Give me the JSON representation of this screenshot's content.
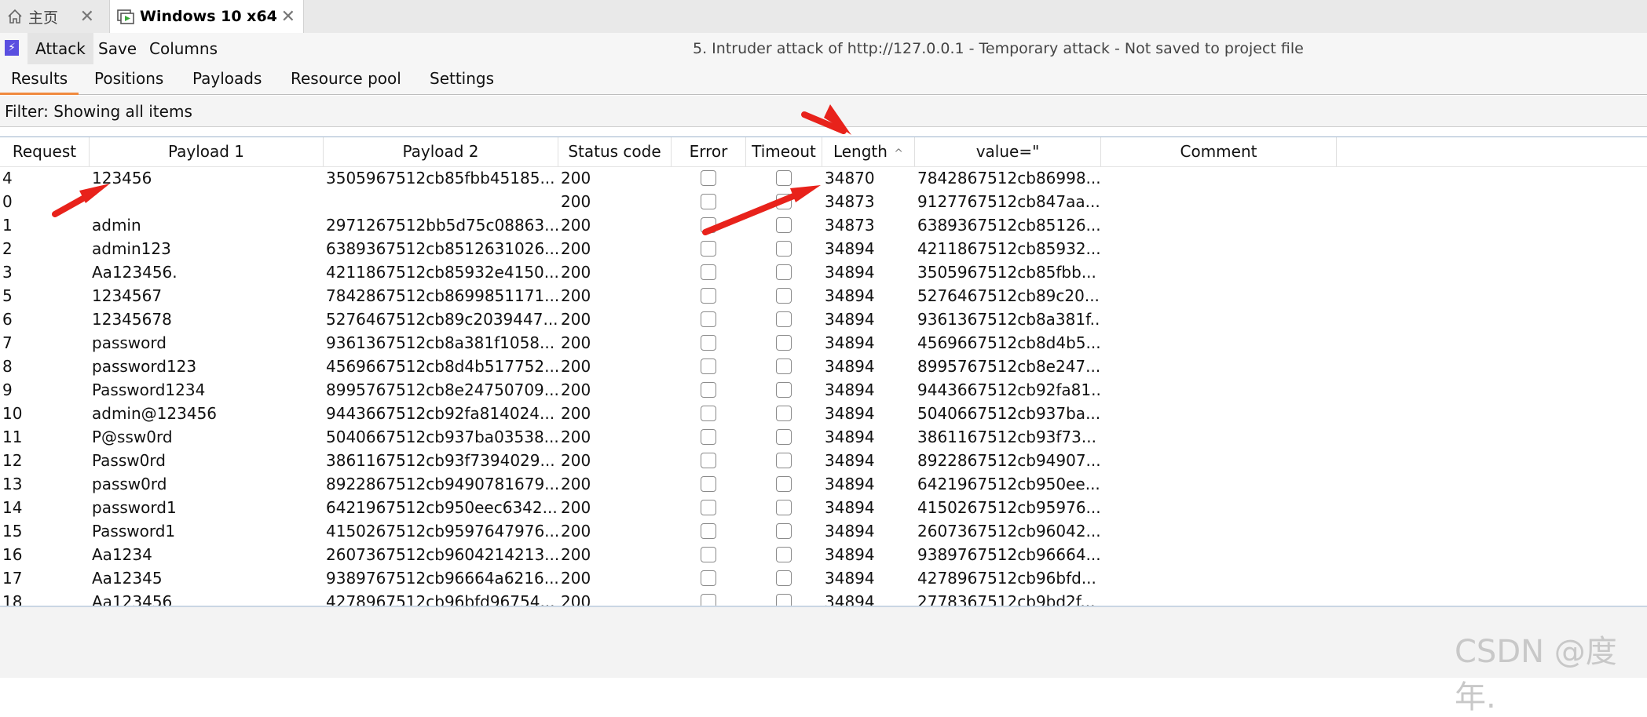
{
  "vm_tabs": [
    {
      "label": "主页",
      "icon": "home-icon",
      "close": "✕"
    },
    {
      "label": "Windows 10 x64",
      "icon": "vm-icon",
      "close": "✕"
    }
  ],
  "menu": {
    "attack": "Attack",
    "save": "Save",
    "columns": "Columns",
    "window_title": "5. Intruder attack of http://127.0.0.1 - Temporary attack - Not saved to project file"
  },
  "subtabs": [
    "Results",
    "Positions",
    "Payloads",
    "Resource pool",
    "Settings"
  ],
  "filter": "Filter: Showing all items",
  "columns": [
    "Request",
    "Payload 1",
    "Payload 2",
    "Status code",
    "Error",
    "Timeout",
    "Length",
    "value=\"",
    "Comment"
  ],
  "sort_indicator": "^",
  "rows": [
    {
      "request": "4",
      "payload1": "123456",
      "payload2": "3505967512cb85fbb45185...",
      "status": "200",
      "length": "34870",
      "value": "7842867512cb86998..."
    },
    {
      "request": "0",
      "payload1": "",
      "payload2": "",
      "status": "200",
      "length": "34873",
      "value": "9127767512cb847aa..."
    },
    {
      "request": "1",
      "payload1": "admin",
      "payload2": "2971267512bb5d75c08863...",
      "status": "200",
      "length": "34873",
      "value": "6389367512cb85126..."
    },
    {
      "request": "2",
      "payload1": "admin123",
      "payload2": "6389367512cb8512631026...",
      "status": "200",
      "length": "34894",
      "value": "4211867512cb85932..."
    },
    {
      "request": "3",
      "payload1": "Aa123456.",
      "payload2": "4211867512cb85932e4150...",
      "status": "200",
      "length": "34894",
      "value": "3505967512cb85fbb..."
    },
    {
      "request": "5",
      "payload1": "1234567",
      "payload2": "7842867512cb8699851171...",
      "status": "200",
      "length": "34894",
      "value": "5276467512cb89c20..."
    },
    {
      "request": "6",
      "payload1": "12345678",
      "payload2": "5276467512cb89c2039447...",
      "status": "200",
      "length": "34894",
      "value": "9361367512cb8a381f..."
    },
    {
      "request": "7",
      "payload1": "password",
      "payload2": "9361367512cb8a381f1058...",
      "status": "200",
      "length": "34894",
      "value": "4569667512cb8d4b5..."
    },
    {
      "request": "8",
      "payload1": "password123",
      "payload2": "4569667512cb8d4b517752...",
      "status": "200",
      "length": "34894",
      "value": "8995767512cb8e247..."
    },
    {
      "request": "9",
      "payload1": "Password1234",
      "payload2": "8995767512cb8e24750709...",
      "status": "200",
      "length": "34894",
      "value": "9443667512cb92fa81..."
    },
    {
      "request": "10",
      "payload1": "admin@123456",
      "payload2": "9443667512cb92fa814024...",
      "status": "200",
      "length": "34894",
      "value": "5040667512cb937ba..."
    },
    {
      "request": "11",
      "payload1": "P@ssw0rd",
      "payload2": "5040667512cb937ba03538...",
      "status": "200",
      "length": "34894",
      "value": "3861167512cb93f73..."
    },
    {
      "request": "12",
      "payload1": "Passw0rd",
      "payload2": "3861167512cb93f7394029...",
      "status": "200",
      "length": "34894",
      "value": "8922867512cb94907..."
    },
    {
      "request": "13",
      "payload1": "passw0rd",
      "payload2": "8922867512cb9490781679...",
      "status": "200",
      "length": "34894",
      "value": "6421967512cb950ee..."
    },
    {
      "request": "14",
      "payload1": "password1",
      "payload2": "6421967512cb950eec6342...",
      "status": "200",
      "length": "34894",
      "value": "4150267512cb95976..."
    },
    {
      "request": "15",
      "payload1": "Password1",
      "payload2": "4150267512cb9597647976...",
      "status": "200",
      "length": "34894",
      "value": "2607367512cb96042..."
    },
    {
      "request": "16",
      "payload1": "Aa1234",
      "payload2": "2607367512cb9604214213...",
      "status": "200",
      "length": "34894",
      "value": "9389767512cb96664..."
    },
    {
      "request": "17",
      "payload1": "Aa12345",
      "payload2": "9389767512cb96664a6216...",
      "status": "200",
      "length": "34894",
      "value": "4278967512cb96bfd..."
    },
    {
      "request": "18",
      "payload1": "Aa123456",
      "payload2": "4278967512cb96bfd96754...",
      "status": "200",
      "length": "34894",
      "value": "2778367512cb9bd2f..."
    }
  ],
  "watermark": "CSDN @度年.",
  "annotation_color": "#e8221b"
}
